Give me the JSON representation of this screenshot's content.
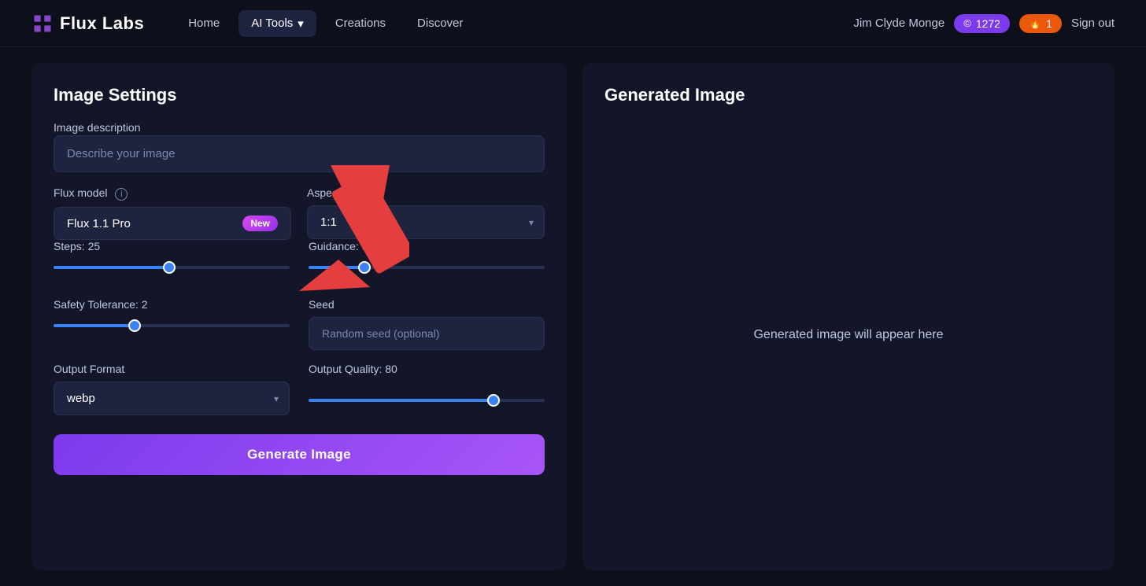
{
  "app": {
    "logo_text": "Flux Labs",
    "logo_icon": "⬡"
  },
  "navbar": {
    "links": [
      {
        "label": "Home",
        "active": false
      },
      {
        "label": "AI Tools",
        "active": true,
        "has_dropdown": true
      },
      {
        "label": "Creations",
        "active": false
      },
      {
        "label": "Discover",
        "active": false
      }
    ],
    "user_name": "Jim Clyde Monge",
    "credits_purple": "1272",
    "credits_orange": "1",
    "sign_out_label": "Sign out"
  },
  "left_panel": {
    "title": "Image Settings",
    "image_description_label": "Image description",
    "image_description_placeholder": "Describe your image",
    "flux_model_label": "Flux model",
    "flux_model_value": "Flux 1.1 Pro",
    "flux_model_badge": "New",
    "aspect_ratio_label": "Aspect Ratio",
    "aspect_ratio_value": "1:1",
    "steps_label": "Steps: 25",
    "steps_value": 25,
    "steps_max": 50,
    "steps_fill_pct": "50%",
    "guidance_label": "Guidance: 3",
    "guidance_value": 3,
    "guidance_max": 10,
    "guidance_fill_pct": "55%",
    "safety_tolerance_label": "Safety Tolerance: 2",
    "safety_tolerance_value": 2,
    "safety_tolerance_max": 6,
    "safety_tolerance_fill_pct": "33%",
    "seed_label": "Seed",
    "seed_placeholder": "Random seed (optional)",
    "output_format_label": "Output Format",
    "output_format_value": "webp",
    "output_quality_label": "Output Quality: 80",
    "output_quality_value": 80,
    "output_quality_max": 100,
    "output_quality_fill_pct": "80%",
    "generate_button_label": "Generate Image"
  },
  "right_panel": {
    "title": "Generated Image",
    "placeholder_text": "Generated image will appear here"
  },
  "icons": {
    "info": "i",
    "chevron_down": "▾",
    "coin": "©",
    "flame": "🔥"
  }
}
